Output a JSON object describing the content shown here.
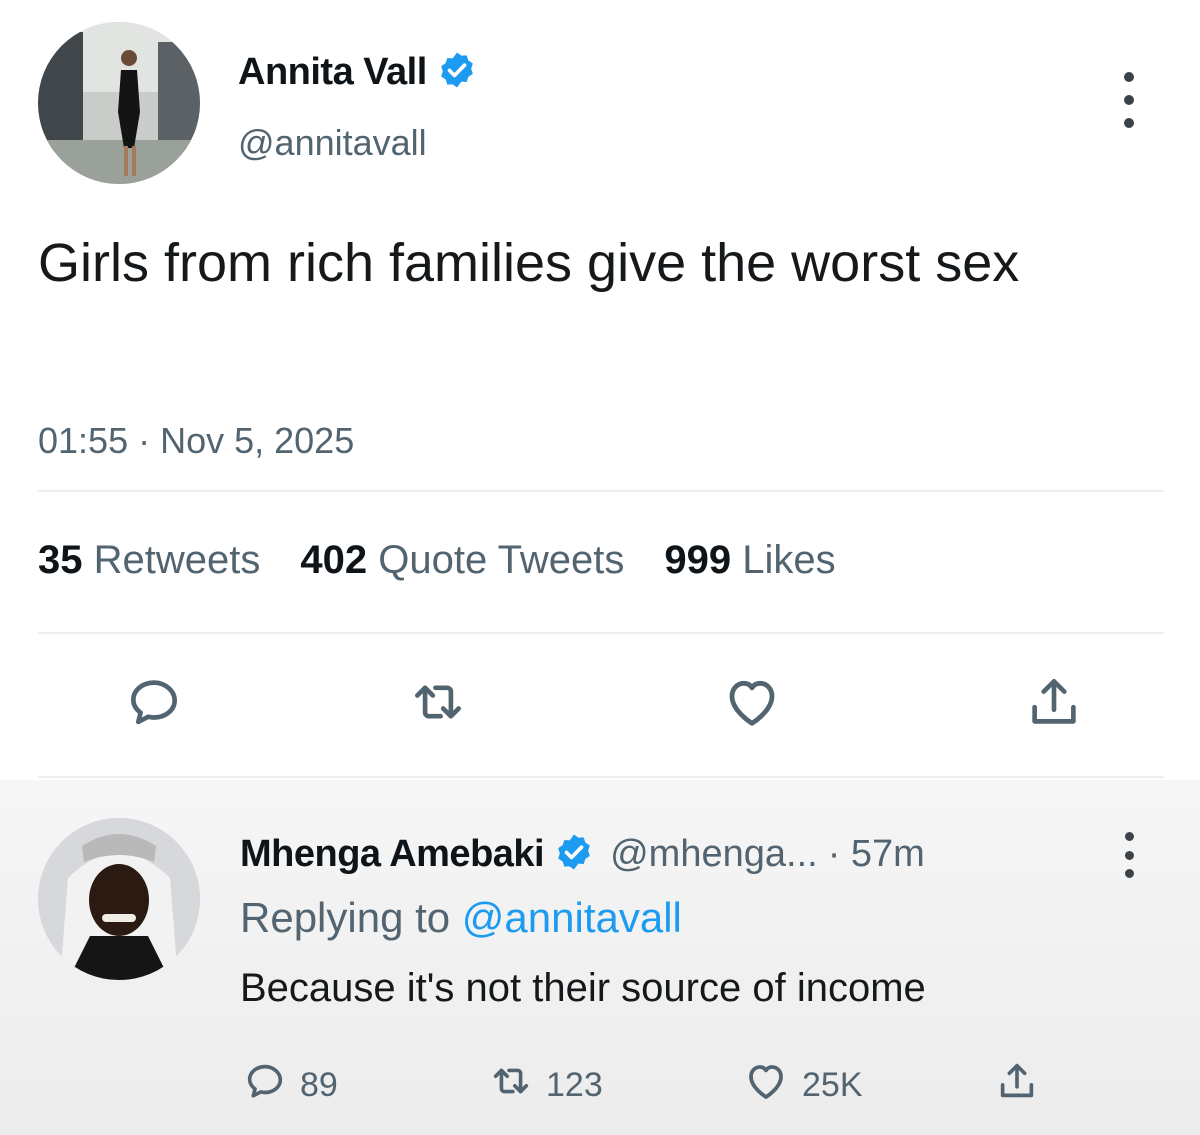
{
  "tweet": {
    "author_name": "Annita Vall",
    "handle": "@annitavall",
    "text": "Girls from rich families give the worst sex",
    "timestamp": "01:55 · Nov 5, 2025",
    "stats": [
      {
        "count": "35",
        "label": "Retweets"
      },
      {
        "count": "402",
        "label": "Quote Tweets"
      },
      {
        "count": "999",
        "label": "Likes"
      }
    ],
    "icons": {
      "verified": "verified-badge-icon",
      "more": "more-options-icon",
      "reply": "reply-icon",
      "retweet": "retweet-icon",
      "like": "heart-icon",
      "share": "share-icon"
    }
  },
  "reply": {
    "author_name": "Mhenga Amebaki",
    "handle": "@mhenga...",
    "time": "· 57m",
    "replying_prefix": "Replying to",
    "replying_mention": "@annitavall",
    "text": "Because it's not their source of income",
    "counts": {
      "replies": "89",
      "retweets": "123",
      "likes": "25K"
    }
  },
  "colors": {
    "accent": "#1d9bf0",
    "secondary_text": "#536471",
    "primary_text": "#0f1419",
    "divider": "#eceeef"
  }
}
